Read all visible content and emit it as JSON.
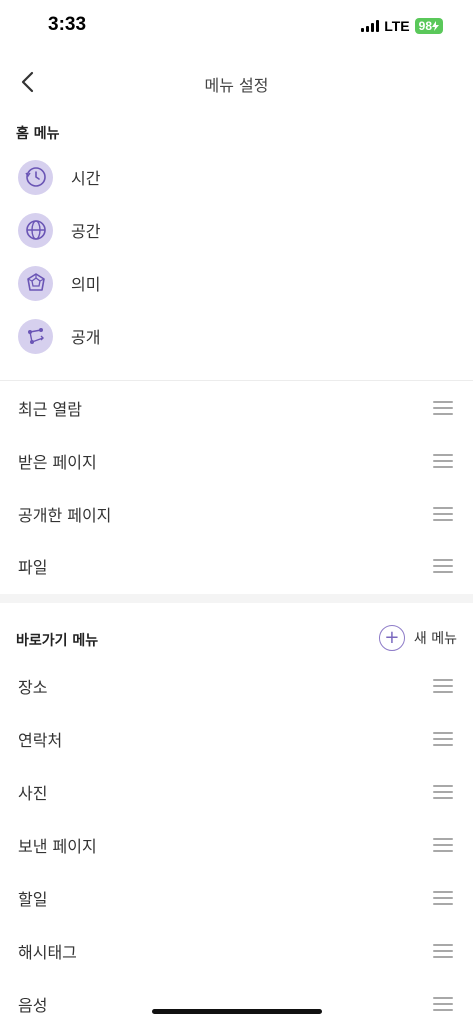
{
  "status_bar": {
    "time": "3:33",
    "network": "LTE",
    "battery": "98"
  },
  "header": {
    "title": "메뉴 설정"
  },
  "home_menu": {
    "title": "홈 메뉴",
    "items": [
      {
        "label": "시간",
        "icon": "clock-history-icon"
      },
      {
        "label": "공간",
        "icon": "globe-icon"
      },
      {
        "label": "의미",
        "icon": "star-shape-icon"
      },
      {
        "label": "공개",
        "icon": "share-route-icon"
      }
    ]
  },
  "list_menu": {
    "items": [
      {
        "label": "최근 열람"
      },
      {
        "label": "받은 페이지"
      },
      {
        "label": "공개한 페이지"
      },
      {
        "label": "파일"
      }
    ]
  },
  "shortcut_menu": {
    "title": "바로가기 메뉴",
    "add_label": "새 메뉴",
    "items": [
      {
        "label": "장소"
      },
      {
        "label": "연락처"
      },
      {
        "label": "사진"
      },
      {
        "label": "보낸 페이지"
      },
      {
        "label": "할일"
      },
      {
        "label": "해시태그"
      },
      {
        "label": "음성"
      }
    ]
  },
  "colors": {
    "accent": "#7a68be",
    "icon_bg": "#d6d0ee",
    "battery": "#5ac85a"
  }
}
